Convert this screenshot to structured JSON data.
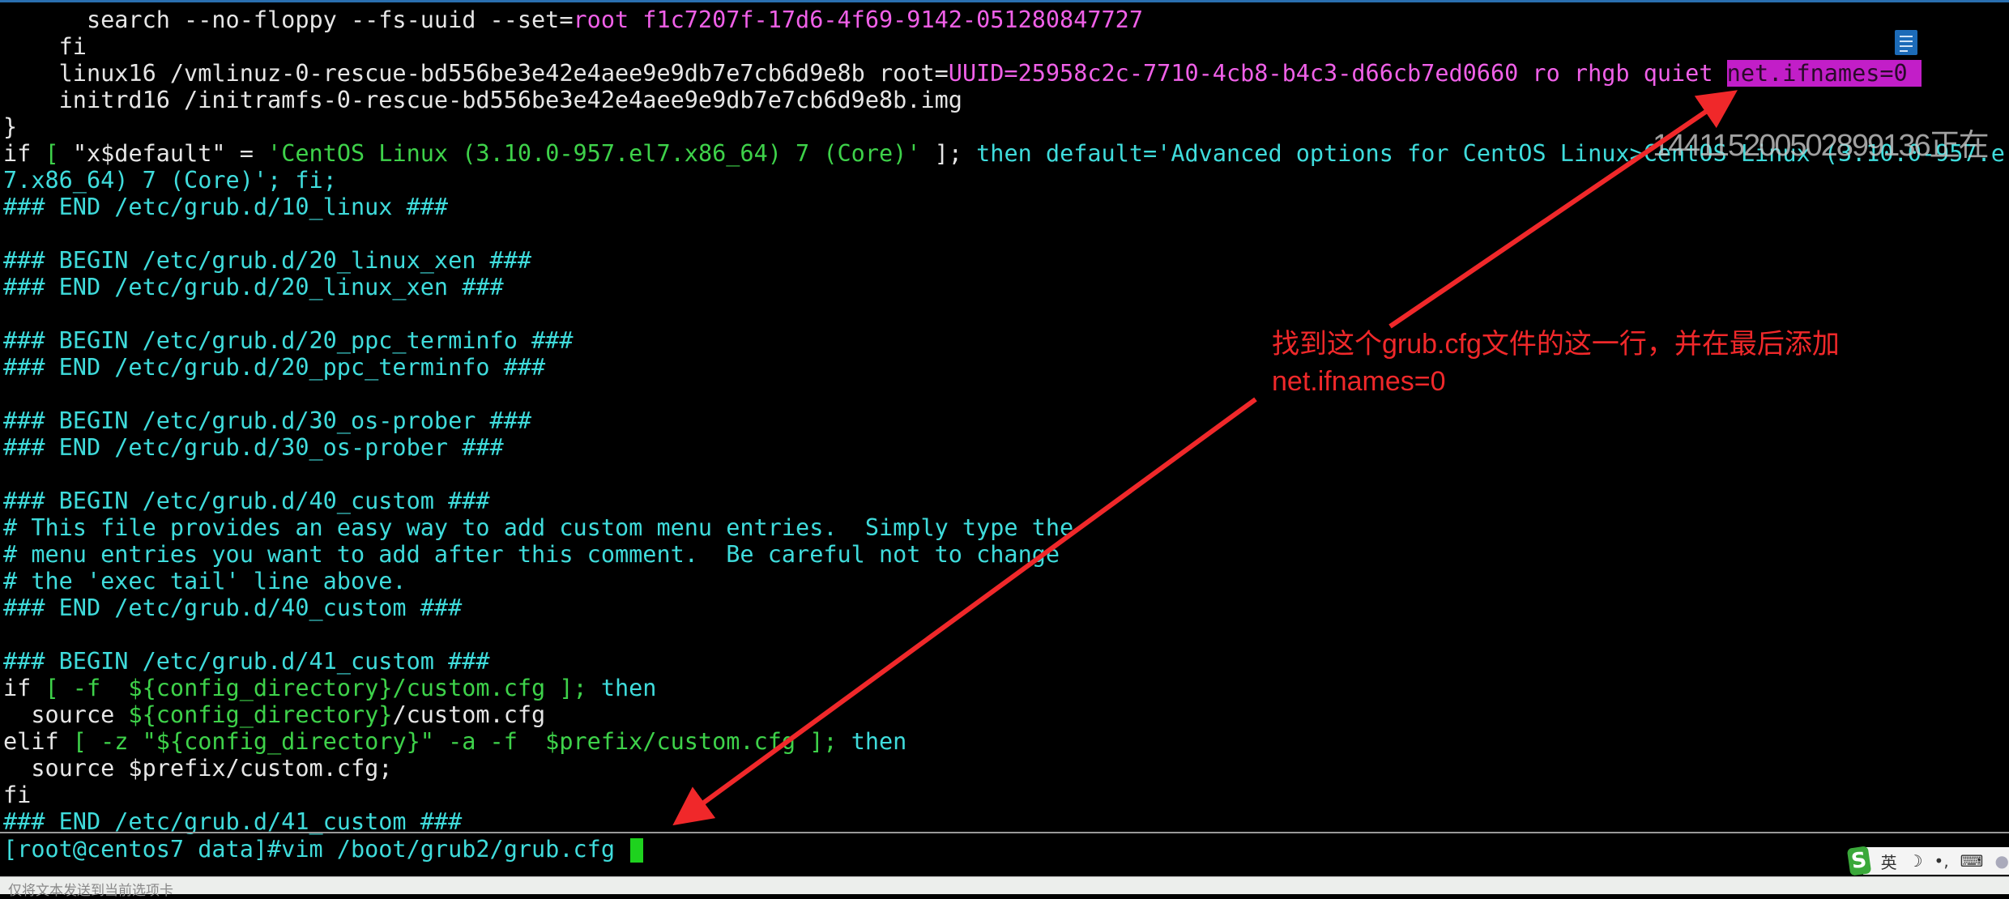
{
  "colors": {
    "white": "#e6e6e6",
    "magenta": "#f060e8",
    "cyan": "#3fdcdc",
    "green": "#3ed24a",
    "highlight": "#c21ec8",
    "arrow": "#f0282a"
  },
  "terminal": {
    "rows": [
      [
        [
          "      search --no-floppy --fs-uuid --set=",
          "w"
        ],
        [
          "root f1c7207f-17d6-4f69-9142-051280847727",
          "m"
        ]
      ],
      [
        [
          "    fi",
          "w"
        ]
      ],
      [
        [
          "    linux16 /vmlinuz-0-rescue-bd556be3e42e4aee9e9db7e7cb6d9e8b root=",
          "w"
        ],
        [
          "UUID=25958c2c-7710-4cb8-b4c3-d66cb7ed0660 ro rhgb quiet ",
          "m"
        ],
        [
          "net.ifnames=0 ",
          "hl"
        ]
      ],
      [
        [
          "    initrd16 /initramfs-0-rescue-bd556be3e42e4aee9e9db7e7cb6d9e8b.img",
          "w"
        ]
      ],
      [
        [
          "}",
          "w"
        ]
      ],
      [
        [
          "if",
          "w"
        ],
        [
          " [ ",
          "g"
        ],
        [
          "\"x$default\" = ",
          "w"
        ],
        [
          "'CentOS Linux (3.10.0-957.el7.x86_64) 7 (Core)'",
          "g"
        ],
        [
          " ]; ",
          "w"
        ],
        [
          "then default='Advanced options for CentOS Linux>CentOS Linux (3.10.0-957.e",
          "c"
        ]
      ],
      [
        [
          "7.x86_64) 7 (Core)'; fi;",
          "c"
        ]
      ],
      [
        [
          "### END /etc/grub.d/10_linux ###",
          "c"
        ]
      ],
      [
        [
          "",
          "w"
        ]
      ],
      [
        [
          "### BEGIN /etc/grub.d/20_linux_xen ###",
          "c"
        ]
      ],
      [
        [
          "### END /etc/grub.d/20_linux_xen ###",
          "c"
        ]
      ],
      [
        [
          "",
          "w"
        ]
      ],
      [
        [
          "### BEGIN /etc/grub.d/20_ppc_terminfo ###",
          "c"
        ]
      ],
      [
        [
          "### END /etc/grub.d/20_ppc_terminfo ###",
          "c"
        ]
      ],
      [
        [
          "",
          "w"
        ]
      ],
      [
        [
          "### BEGIN /etc/grub.d/30_os-prober ###",
          "c"
        ]
      ],
      [
        [
          "### END /etc/grub.d/30_os-prober ###",
          "c"
        ]
      ],
      [
        [
          "",
          "w"
        ]
      ],
      [
        [
          "### BEGIN /etc/grub.d/40_custom ###",
          "c"
        ]
      ],
      [
        [
          "# This file provides an easy way to add custom menu entries.  Simply type the",
          "c"
        ]
      ],
      [
        [
          "# menu entries you want to add after this comment.  Be careful not to change",
          "c"
        ]
      ],
      [
        [
          "# the 'exec tail' line above.",
          "c"
        ]
      ],
      [
        [
          "### END /etc/grub.d/40_custom ###",
          "c"
        ]
      ],
      [
        [
          "",
          "w"
        ]
      ],
      [
        [
          "### BEGIN /etc/grub.d/41_custom ###",
          "c"
        ]
      ],
      [
        [
          "if",
          "w"
        ],
        [
          " [ -f  ${config_directory}/custom.cfg ]; ",
          "g"
        ],
        [
          "then",
          "c"
        ]
      ],
      [
        [
          "  source ",
          "w"
        ],
        [
          "${config_directory}",
          "g"
        ],
        [
          "/custom.cfg",
          "w"
        ]
      ],
      [
        [
          "elif",
          "w"
        ],
        [
          " [ -z \"${config_directory}\" -a -f  $prefix/custom.cfg ]; ",
          "g"
        ],
        [
          "then",
          "c"
        ]
      ],
      [
        [
          "  source $prefix/custom.cfg;",
          "w"
        ]
      ],
      [
        [
          "fi",
          "w"
        ]
      ],
      [
        [
          "### END /etc/grub.d/41_custom ###",
          "c"
        ]
      ]
    ],
    "prompt": "[root@centos7 data]#vim /boot/grub2/grub.cfg "
  },
  "overlay_id": "144115200502899136正在",
  "annotation": {
    "line1": "找到这个grub.cfg文件的这一行，并在最后添加",
    "line2": "net.ifnames=0"
  },
  "ime": {
    "logo": "S",
    "lang": "英",
    "icons": [
      "moon-icon",
      "punctuation-icon",
      "keyboard-icon",
      "user-icon"
    ]
  },
  "status_bar": {
    "text": "仅将文本发送到当前选项卡"
  }
}
